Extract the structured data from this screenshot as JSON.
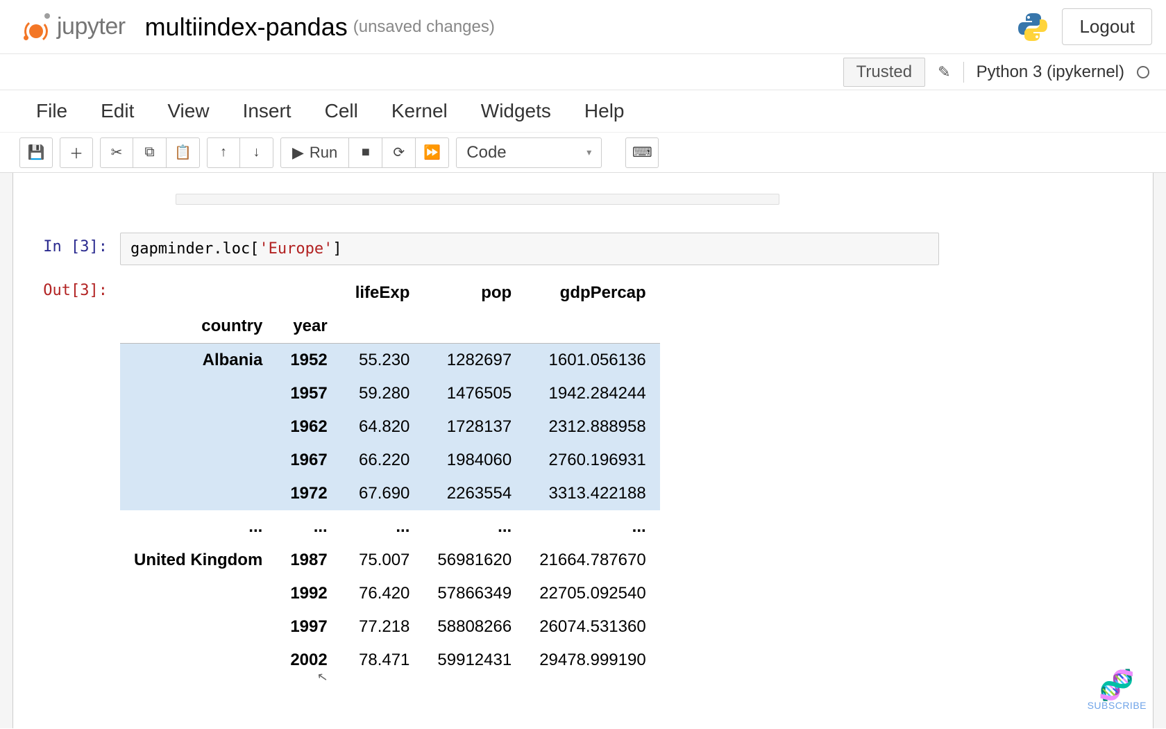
{
  "header": {
    "logo_text": "jupyter",
    "notebook_title": "multiindex-pandas",
    "notebook_status": "(unsaved changes)",
    "logout_label": "Logout"
  },
  "status_bar": {
    "trusted_label": "Trusted",
    "kernel_name": "Python 3 (ipykernel)"
  },
  "menubar": {
    "items": [
      "File",
      "Edit",
      "View",
      "Insert",
      "Cell",
      "Kernel",
      "Widgets",
      "Help"
    ]
  },
  "toolbar": {
    "run_label": "Run",
    "celltype_value": "Code"
  },
  "cell": {
    "in_prompt": "In [3]:",
    "out_prompt": "Out[3]:",
    "code_prefix": "gapminder.loc[",
    "code_string": "'Europe'",
    "code_suffix": "]"
  },
  "table": {
    "value_cols": [
      "lifeExp",
      "pop",
      "gdpPercap"
    ],
    "index_cols": [
      "country",
      "year"
    ],
    "ellipsis": "...",
    "rows_top": [
      {
        "country": "Albania",
        "year": "1952",
        "lifeExp": "55.230",
        "pop": "1282697",
        "gdp": "1601.056136"
      },
      {
        "country": "",
        "year": "1957",
        "lifeExp": "59.280",
        "pop": "1476505",
        "gdp": "1942.284244"
      },
      {
        "country": "",
        "year": "1962",
        "lifeExp": "64.820",
        "pop": "1728137",
        "gdp": "2312.888958"
      },
      {
        "country": "",
        "year": "1967",
        "lifeExp": "66.220",
        "pop": "1984060",
        "gdp": "2760.196931"
      },
      {
        "country": "",
        "year": "1972",
        "lifeExp": "67.690",
        "pop": "2263554",
        "gdp": "3313.422188"
      }
    ],
    "rows_bottom": [
      {
        "country": "United Kingdom",
        "year": "1987",
        "lifeExp": "75.007",
        "pop": "56981620",
        "gdp": "21664.787670"
      },
      {
        "country": "",
        "year": "1992",
        "lifeExp": "76.420",
        "pop": "57866349",
        "gdp": "22705.092540"
      },
      {
        "country": "",
        "year": "1997",
        "lifeExp": "77.218",
        "pop": "58808266",
        "gdp": "26074.531360"
      },
      {
        "country": "",
        "year": "2002",
        "lifeExp": "78.471",
        "pop": "59912431",
        "gdp": "29478.999190"
      }
    ]
  },
  "badge": {
    "subscribe_label": "SUBSCRIBE"
  }
}
